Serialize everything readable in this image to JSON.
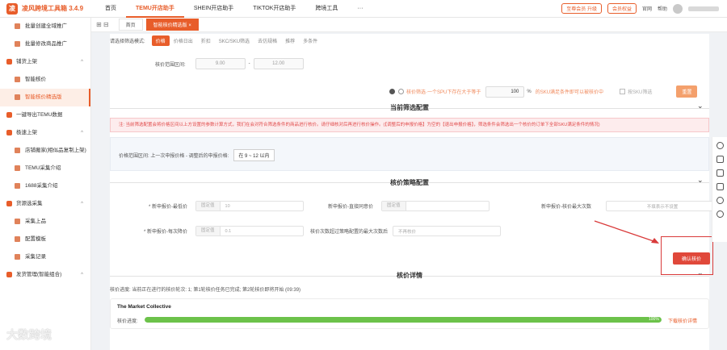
{
  "app": {
    "logo_text": "凌",
    "title": "凌风跨境工具箱 3.4.9"
  },
  "topnav": {
    "items": [
      "首页",
      "TEMU开店助手",
      "SHEIN开店助手",
      "TIKTOK开店助手",
      "跨境工具",
      "···"
    ],
    "active_index": 1
  },
  "topright": {
    "vip_label": "至尊会员 升级",
    "member_label": "会员权益",
    "site_label": "官网",
    "help_label": "帮助"
  },
  "sidebar": {
    "items": [
      {
        "label": "批量创建全域推广",
        "type": "item"
      },
      {
        "label": "批量修改商品推广",
        "type": "item"
      },
      {
        "label": "铺货上架",
        "type": "group",
        "caret": "^"
      },
      {
        "label": "智能核价",
        "type": "item"
      },
      {
        "label": "智能核价精选版",
        "type": "item",
        "active": true
      },
      {
        "label": "一键导出TEMU数据",
        "type": "group"
      },
      {
        "label": "极速上架",
        "type": "group",
        "caret": "^"
      },
      {
        "label": "店铺搬家(相似品复制上架)",
        "type": "item"
      },
      {
        "label": "TEMU采集介绍",
        "type": "item"
      },
      {
        "label": "1688采集介绍",
        "type": "item"
      },
      {
        "label": "货源选采集",
        "type": "group",
        "caret": "^"
      },
      {
        "label": "采集上品",
        "type": "item"
      },
      {
        "label": "配置模板",
        "type": "item"
      },
      {
        "label": "采集记录",
        "type": "item"
      },
      {
        "label": "发货管理(智能组合)",
        "type": "group",
        "caret": "^"
      }
    ]
  },
  "tabbar": {
    "tools_label": "⊞ ⊟",
    "tabs": [
      {
        "label": "首页",
        "active": false
      },
      {
        "label": "智能核价精选版 ×",
        "active": true
      }
    ]
  },
  "mode_row": {
    "label": "请选择筛选模式:",
    "options": [
      "价格",
      "价格日出",
      "折扣",
      "SKC/SKU筛选",
      "去仿规格",
      "推荐",
      "多条件"
    ],
    "active_index": 0
  },
  "price_range": {
    "label": "核价范围区间:",
    "min": "9.00",
    "max": "12.00"
  },
  "sku_row": {
    "text": "核价筛选·一个SPU下存在大于等于",
    "percent_value": "100",
    "percent_unit": "%",
    "suffix_text": "的SKU满足条件即可以被核价中",
    "checkbox_label": "按SKU筛选",
    "reset_label": "重置"
  },
  "section_current": {
    "title": "当前筛选配置"
  },
  "warning_text": "注: 当前筛选配置会将价格区间以上方设置的参数计算方式，我们在会对符合筛选条件的商品进行核价。请仔细核对后再进行核价操作。(【调整后的申报价格】为空的【退出申报价格】，筛选条件会筛选出一个核价的订单下全部SKU满足条件的情况)",
  "filter_summary": {
    "label": "价格范围区间: 上一次申报价格 - 调整后的申报价格:",
    "tag": "在 9 ~ 12 以内"
  },
  "section_strategy": {
    "title": "核价策略配置"
  },
  "strategy_form": {
    "f1_label": "* 新申报价-最低价",
    "f1_sub": "固定值",
    "f1_val": "10",
    "f2_label": "新申报价-直接同意价",
    "f2_sub": "固定值",
    "f3_label": "新申报价-核价最大次数",
    "f3_val": "不填表示不设置",
    "f4_label": "* 新申报价-每次降价",
    "f4_sub": "固定值",
    "f4_val": "0.1",
    "f5_label": "核价次数超过策略配置的最大次数后",
    "f5_val": "不再核价"
  },
  "confirm_button": {
    "label": "确认核价"
  },
  "section_detail": {
    "title": "核价详情"
  },
  "progress_status": "核价进度:  当前正在进行的核价轮次: 1;   第1轮核价任务已完成;   第2轮核价即将开始 (09:39)",
  "store_card": {
    "store_name": "The Market Collective",
    "progress_label": "核价进度:",
    "progress_percent": 100,
    "progress_text": "100%",
    "detail_link": "下载核价详情"
  },
  "watermark": "大数跨境",
  "colors": {
    "accent": "#e85d2a",
    "danger": "#e0483a",
    "progress": "#6cc24a",
    "annotation": "#d93a3a"
  }
}
